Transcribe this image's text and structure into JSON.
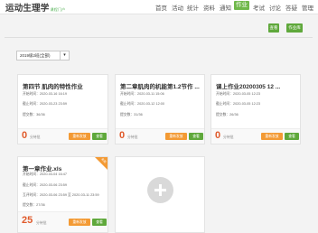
{
  "app": {
    "logo_main": "运动生理学",
    "logo_sub": "课程门户"
  },
  "nav": [
    {
      "label": "首页",
      "active": false
    },
    {
      "label": "活动",
      "active": false
    },
    {
      "label": "统计",
      "active": false
    },
    {
      "label": "资料",
      "active": false
    },
    {
      "label": "通知",
      "active": false
    },
    {
      "label": "作业",
      "active": true
    },
    {
      "label": "考试",
      "active": false
    },
    {
      "label": "讨论",
      "active": false
    },
    {
      "label": "答疑",
      "active": false
    },
    {
      "label": "管理",
      "active": false
    }
  ],
  "actions": {
    "button1": "查看",
    "button2": "作业库"
  },
  "filter": {
    "selected": "2019级2班(全部)"
  },
  "cards": [
    {
      "title": "第四节 肌肉的特性作业",
      "start": "开始时间：2020-03-16 16:19",
      "end": "截止时间：2020-03-23 23:59",
      "submitted": "提交数：36/36",
      "score": "0",
      "score_label": "分待批",
      "btn_orange": "重新发放",
      "btn_green": "查看"
    },
    {
      "title": "第二章肌肉的机能第1.2节作 ...",
      "start": "开始时间：2020-03-11 15:06",
      "end": "截止时间：2020-03-12 12:00",
      "submitted": "提交数：31/36",
      "score": "0",
      "score_label": "分待批",
      "btn_orange": "重新发放",
      "btn_green": "查看"
    },
    {
      "title": "课上作业20200305 12 ...",
      "start": "开始时间：2020-03-05 12:23",
      "end": "截止时间：2020-03-05 12:23",
      "submitted": "提交数：26/36",
      "score": "0",
      "score_label": "分待批",
      "btn_orange": "重新发放",
      "btn_green": "查看"
    },
    {
      "title": "第一章作业.xls",
      "corner": "未批",
      "start": "开始时间：2020-03-04 16:47",
      "end": "截止时间：2020-03-06 23:59",
      "extra": "互评时间：2020-03-06 23:59 至 2020-03-11 23:59",
      "submitted": "提交数：27/36",
      "score": "25",
      "score_label": "分待批",
      "btn_orange": "重新发放",
      "btn_green": "查看"
    }
  ]
}
